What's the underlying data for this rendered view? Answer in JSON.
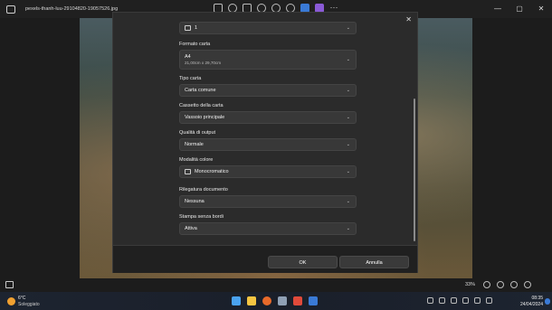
{
  "app": {
    "filename": "pexels-thanh-luu-29104820-19057526.jpg"
  },
  "print_dialog": {
    "pages": {
      "value": "1"
    },
    "fields": [
      {
        "label": "Formato carta",
        "value": "A4",
        "sub": "21,00cm x 29,70cm"
      },
      {
        "label": "Tipo carta",
        "value": "Carta comune"
      },
      {
        "label": "Cassetto della carta",
        "value": "Vassoio principale"
      },
      {
        "label": "Qualità di output",
        "value": "Normale"
      },
      {
        "label": "Modalità colore",
        "value": "Monocromatico"
      },
      {
        "label": "Rilegatura documento",
        "value": "Nessuna"
      },
      {
        "label": "Stampa senza bordi",
        "value": "Attiva"
      }
    ],
    "ok_label": "OK",
    "cancel_label": "Annulla"
  },
  "viewer": {
    "zoom": "33%"
  },
  "taskbar": {
    "weather_temp": "6°C",
    "weather_desc": "Soleggiato",
    "time": "08:35",
    "date": "24/04/2024"
  },
  "colors": {
    "accent": "#3a7ad6",
    "dialog_bg": "#2b2b2b"
  }
}
